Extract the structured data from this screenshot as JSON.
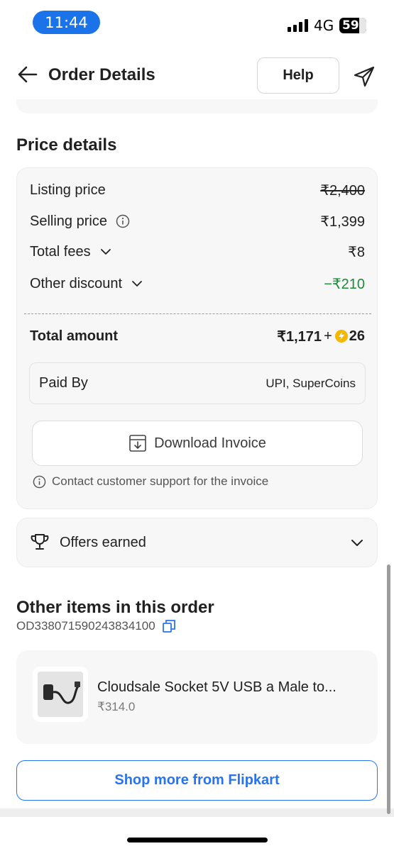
{
  "status_bar": {
    "time": "11:44",
    "network": "4G",
    "battery": "59"
  },
  "header": {
    "title": "Order Details",
    "help_label": "Help"
  },
  "price_details": {
    "title": "Price details",
    "rows": [
      {
        "label": "Listing price",
        "value": "₹2,400"
      },
      {
        "label": "Selling price",
        "value": "₹1,399"
      },
      {
        "label": "Total fees",
        "value": "₹8"
      },
      {
        "label": "Other discount",
        "value": "−₹210"
      }
    ],
    "total_label": "Total amount",
    "total_value": "₹1,171",
    "total_plus": "+",
    "supercoins": "26",
    "paid_by_label": "Paid By",
    "paid_by_value": "UPI, SuperCoins",
    "download_label": "Download Invoice",
    "support_note": "Contact customer support for the invoice"
  },
  "offers": {
    "label": "Offers earned"
  },
  "other_items": {
    "title": "Other items in this order",
    "order_id": "OD338071590243834100",
    "items": [
      {
        "name": "Cloudsale Socket 5V USB a Male to...",
        "price": "₹314.0"
      }
    ]
  },
  "shop_more_label": "Shop more from Flipkart",
  "colors": {
    "accent": "#2874f0",
    "discount": "#1d8a3a",
    "supercoin": "#f5b800",
    "time_pill": "#1a73e8"
  }
}
